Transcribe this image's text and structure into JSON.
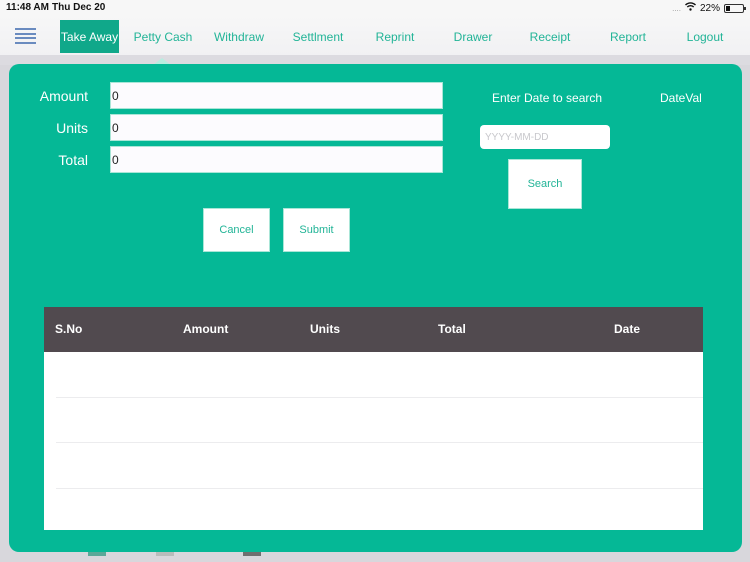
{
  "status_bar": {
    "time": "11:48 AM",
    "date": "Thu Dec 20",
    "signal": "....",
    "wifi_icon": "wifi-icon",
    "battery_percent": "22%",
    "battery_icon": "battery-icon"
  },
  "nav": {
    "menu_icon": "hamburger-menu-icon",
    "items": [
      {
        "label": "Take Away",
        "active": true
      },
      {
        "label": "Petty Cash",
        "active": false
      },
      {
        "label": "Withdraw",
        "active": false
      },
      {
        "label": "Settlment",
        "active": false
      },
      {
        "label": "Reprint",
        "active": false
      },
      {
        "label": "Drawer",
        "active": false
      },
      {
        "label": "Receipt",
        "active": false
      },
      {
        "label": "Report",
        "active": false
      },
      {
        "label": "Logout",
        "active": false
      }
    ]
  },
  "form": {
    "fields": [
      {
        "label": "Amount",
        "value": "0"
      },
      {
        "label": "Units",
        "value": "0"
      },
      {
        "label": "Total",
        "value": "0"
      }
    ],
    "cancel_label": "Cancel",
    "submit_label": "Submit"
  },
  "search": {
    "label": "Enter Date to  search",
    "date_value_label": "DateVal",
    "date_input_placeholder": "YYYY-MM-DD",
    "date_input_value": "",
    "search_label": "Search"
  },
  "table": {
    "columns": [
      "S.No",
      "Amount",
      "Units",
      "Total",
      "Date"
    ],
    "rows": []
  },
  "colors": {
    "accent": "#05b896",
    "nav_active": "#10a88a",
    "nav_text": "#22b497",
    "table_header": "#514a4f"
  }
}
